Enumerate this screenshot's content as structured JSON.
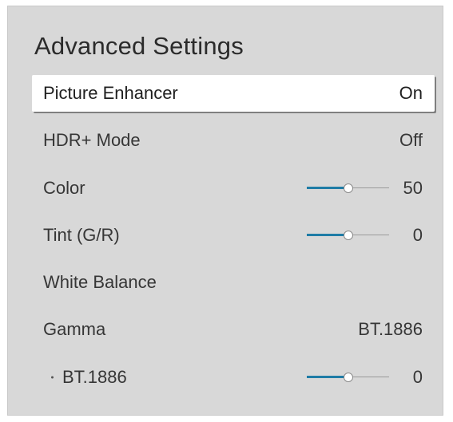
{
  "menu": {
    "title": "Advanced Settings",
    "items": [
      {
        "label": "Picture Enhancer",
        "value": "On",
        "selected": true
      },
      {
        "label": "HDR+ Mode",
        "value": "Off"
      },
      {
        "label": "Color",
        "value": "50",
        "slider_level": 0.5
      },
      {
        "label": "Tint (G/R)",
        "value": "0",
        "slider_level": 0.5
      },
      {
        "label": "White Balance",
        "value": ""
      },
      {
        "label": "Gamma",
        "value": "BT.1886"
      },
      {
        "label": "BT.1886",
        "value": "0",
        "slider_level": 0.5,
        "sub": true
      }
    ]
  },
  "colors": {
    "panel_background": "#d8d8d8",
    "highlight_background": "#ffffff",
    "slider_fill": "#1f7ca6",
    "text": "#363636"
  }
}
